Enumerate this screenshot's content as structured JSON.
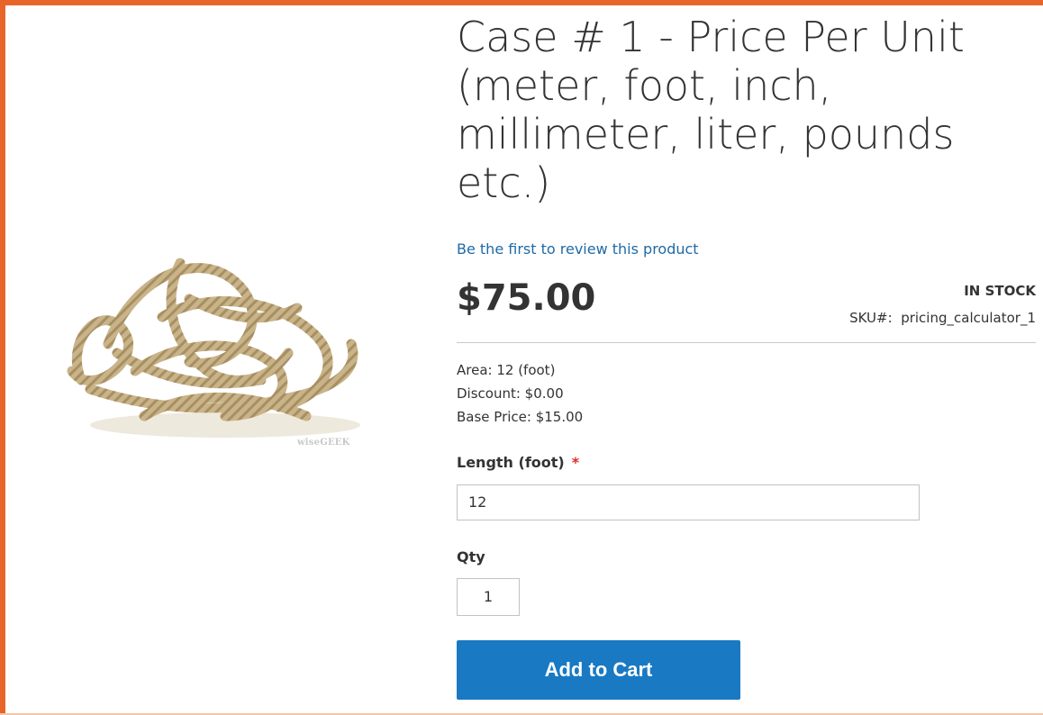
{
  "product": {
    "title": "Case # 1 - Price Per Unit (meter, foot, inch, millimeter, liter, pounds etc.)",
    "review_link": "Be the first to review this product",
    "price": "$75.00",
    "stock": "IN STOCK",
    "sku_label": "SKU#:",
    "sku_value": "pricing_calculator_1",
    "image_watermark": "wiseGEEK"
  },
  "details": {
    "area": "Area: 12 (foot)",
    "discount": "Discount: $0.00",
    "base_price": "Base Price: $15.00"
  },
  "form": {
    "length_label": "Length (foot)",
    "required_mark": "*",
    "length_value": "12",
    "qty_label": "Qty",
    "qty_value": "1",
    "add_to_cart": "Add to Cart"
  },
  "colors": {
    "accent_border": "#e8652a",
    "link": "#1f6aa5",
    "button": "#1979c3",
    "required": "#e02b27"
  },
  "icons": [
    "rope-image"
  ]
}
